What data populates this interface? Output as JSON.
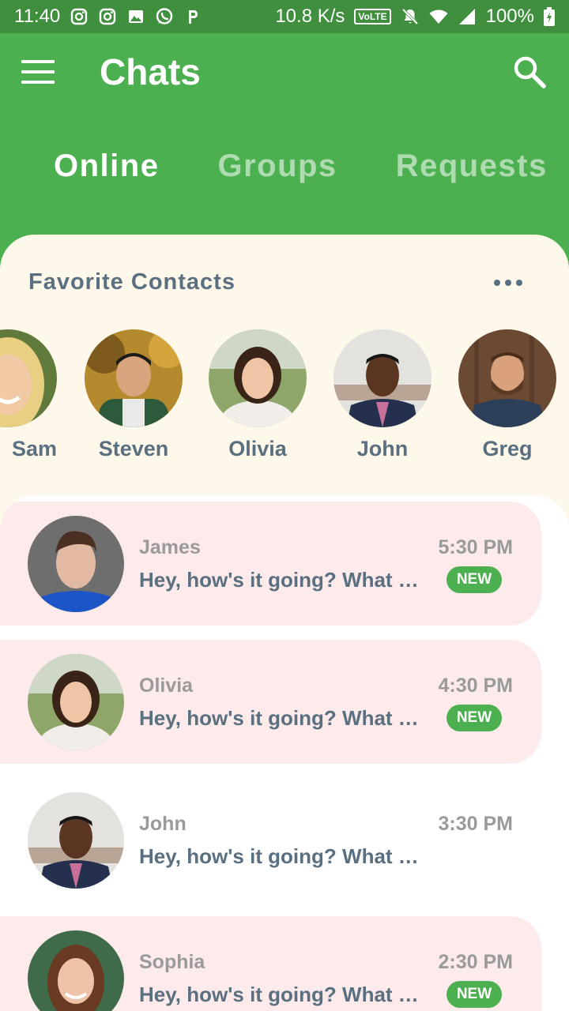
{
  "status_bar": {
    "time": "11:40",
    "speed": "10.8 K/s",
    "network_badge": "VoLTE",
    "battery": "100%",
    "icons": [
      "instagram-icon",
      "instagram-icon",
      "gallery-icon",
      "whatsapp-icon",
      "paytm-icon",
      "mute-icon",
      "wifi-icon",
      "signal-icon",
      "battery-icon"
    ]
  },
  "app_bar": {
    "title": "Chats",
    "menu_icon": "hamburger-menu-icon",
    "search_icon": "search-icon"
  },
  "tabs": [
    {
      "label": "Online",
      "active": true
    },
    {
      "label": "Groups",
      "active": false
    },
    {
      "label": "Requests",
      "active": false
    }
  ],
  "favorites": {
    "title": "Favorite Contacts",
    "more_icon": "more-horizontal-icon",
    "contacts": [
      {
        "name": "Sam"
      },
      {
        "name": "Steven"
      },
      {
        "name": "Olivia"
      },
      {
        "name": "John"
      },
      {
        "name": "Greg"
      }
    ]
  },
  "chats": [
    {
      "name": "James",
      "message": "Hey, how's it going? What …",
      "time": "5:30 PM",
      "badge": "NEW",
      "unread": true
    },
    {
      "name": "Olivia",
      "message": "Hey, how's it going? What …",
      "time": "4:30 PM",
      "badge": "NEW",
      "unread": true
    },
    {
      "name": "John",
      "message": "Hey, how's it going? What …",
      "time": "3:30 PM",
      "badge": "",
      "unread": false
    },
    {
      "name": "Sophia",
      "message": "Hey, how's it going? What …",
      "time": "2:30 PM",
      "badge": "NEW",
      "unread": true
    }
  ],
  "colors": {
    "primary": "#4caf50",
    "status_bar": "#3f8f3f",
    "favorites_bg": "#fef8ea",
    "unread_row": "#fdeaea",
    "text_dark": "#5a6f80",
    "text_muted": "#9a9a9a"
  }
}
